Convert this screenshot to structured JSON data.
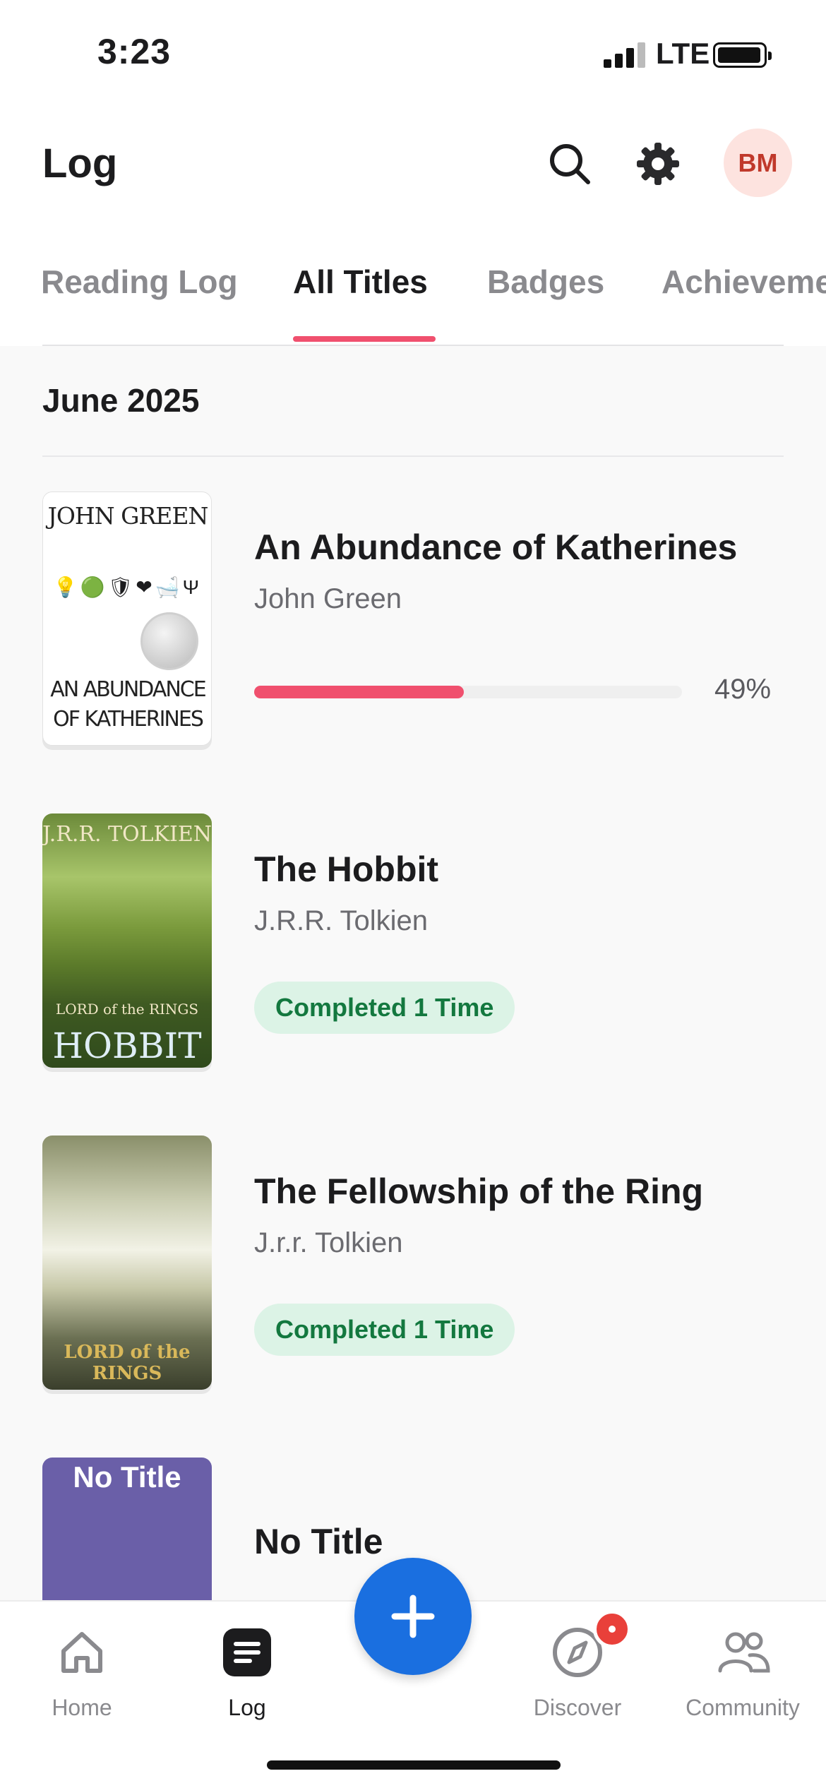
{
  "status_bar": {
    "time": "3:23",
    "network": "LTE"
  },
  "header": {
    "title": "Log",
    "avatar_initials": "BM"
  },
  "tabs": [
    {
      "label": "Reading Log",
      "active": false
    },
    {
      "label": "All Titles",
      "active": true
    },
    {
      "label": "Badges",
      "active": false
    },
    {
      "label": "Achieveme",
      "active": false
    }
  ],
  "section": {
    "title": "June 2025"
  },
  "books": [
    {
      "title": "An Abundance of Katherines",
      "author": "John Green",
      "progress": 0.49,
      "progress_label": "49%",
      "cover": {
        "top": "JOHN GREEN",
        "bottom_line1": "AN ABUNDANCE",
        "bottom_line2": "OF KATHERINES"
      }
    },
    {
      "title": "The Hobbit",
      "author": "J.R.R. Tolkien",
      "status": "Completed 1 Time",
      "cover": {
        "top": "J.R.R. TOLKIEN",
        "mid": "LORD of the RINGS",
        "bottom": "HOBBIT"
      }
    },
    {
      "title": "The Fellowship of the Ring",
      "author": "J.r.r. Tolkien",
      "status": "Completed 1 Time",
      "cover": {
        "bottom": "LORD of the RINGS"
      }
    },
    {
      "title": "No Title",
      "cover": {
        "label": "No Title"
      }
    }
  ],
  "bottom_nav": [
    {
      "label": "Home",
      "icon": "home-icon"
    },
    {
      "label": "Log",
      "icon": "log-icon",
      "active": true
    },
    {
      "label": "Discover",
      "icon": "compass-icon",
      "notification": true
    },
    {
      "label": "Community",
      "icon": "people-icon"
    }
  ],
  "colors": {
    "accent": "#f0506e",
    "fab": "#1a6fe0",
    "completed_bg": "#dcf3e6",
    "completed_text": "#13783f",
    "avatar_bg": "#fde3df"
  }
}
